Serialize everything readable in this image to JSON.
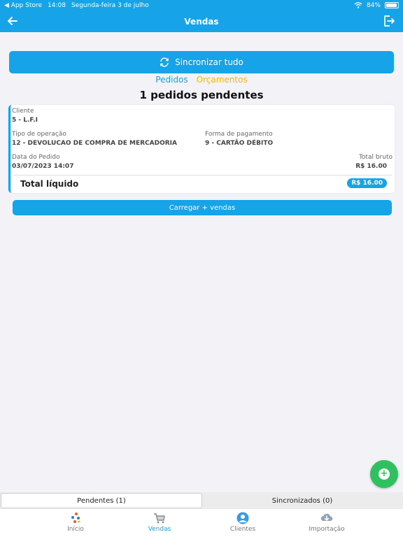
{
  "status_bar": {
    "app_store": "◀ App Store",
    "time": "14:08",
    "date": "Segunda-feira 3 de julho",
    "battery": "84%"
  },
  "header": {
    "title": "Vendas"
  },
  "sync_button": {
    "label": "Sincronizar tudo"
  },
  "tabs": {
    "pedidos": "Pedidos",
    "orcamentos": "Orçamentos"
  },
  "pending_title": "1 pedidos pendentes",
  "order": {
    "cliente_label": "Cliente",
    "cliente_value": "5 - L.F.I",
    "tipo_label": "Tipo de operação",
    "tipo_value": "12 - DEVOLUCAO DE COMPRA DE MERCADORIA",
    "forma_label": "Forma de pagamento",
    "forma_value": "9 - CARTÃO DÉBITO",
    "data_label": "Data do Pedido",
    "data_value": "03/07/2023 14:07",
    "total_bruto_label": "Total bruto",
    "total_bruto_value": "R$ 16.00",
    "total_liquido_label": "Total líquido",
    "total_liquido_value": "R$ 16.00"
  },
  "load_button": {
    "label": "Carregar + vendas"
  },
  "segments": {
    "pendentes": "Pendentes (1)",
    "sincronizados": "Sincronizados (0)"
  },
  "bottom_nav": {
    "inicio": "Início",
    "vendas": "Vendas",
    "clientes": "Clientes",
    "importacao": "Importação"
  },
  "colors": {
    "primary": "#16a3e8",
    "accent": "#f5b800",
    "fab": "#2fc05f"
  }
}
